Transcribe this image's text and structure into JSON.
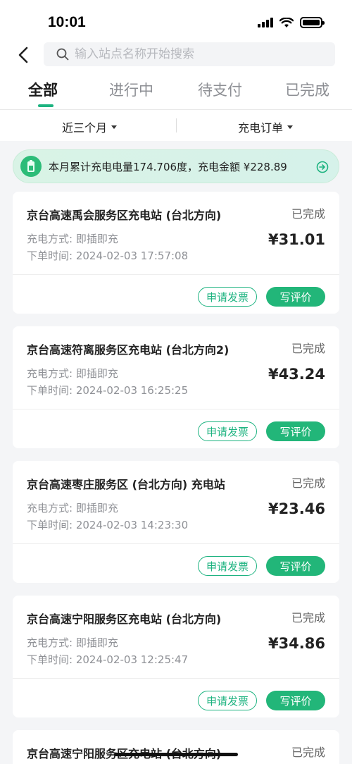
{
  "status_bar": {
    "time": "10:01"
  },
  "search": {
    "placeholder": "输入站点名称开始搜索"
  },
  "tabs": [
    {
      "label": "全部",
      "active": true
    },
    {
      "label": "进行中",
      "active": false
    },
    {
      "label": "待支付",
      "active": false
    },
    {
      "label": "已完成",
      "active": false
    }
  ],
  "filters": {
    "period": "近三个月",
    "order_type": "充电订单"
  },
  "banner": {
    "text": "本月累计充电电量174.706度，充电金额 ¥228.89"
  },
  "orders": [
    {
      "station": "京台高速禹会服务区充电站 (台北方向)",
      "status": "已完成",
      "method": "充电方式: 即插即充",
      "time": "下单时间: 2024-02-03 17:57:08",
      "amount": "¥31.01",
      "invoice_label": "申请发票",
      "review_label": "写评价"
    },
    {
      "station": "京台高速符离服务区充电站 (台北方向2)",
      "status": "已完成",
      "method": "充电方式: 即插即充",
      "time": "下单时间: 2024-02-03 16:25:25",
      "amount": "¥43.24",
      "invoice_label": "申请发票",
      "review_label": "写评价"
    },
    {
      "station": "京台高速枣庄服务区 (台北方向) 充电站",
      "status": "已完成",
      "method": "充电方式: 即插即充",
      "time": "下单时间: 2024-02-03 14:23:30",
      "amount": "¥23.46",
      "invoice_label": "申请发票",
      "review_label": "写评价"
    },
    {
      "station": "京台高速宁阳服务区充电站 (台北方向)",
      "status": "已完成",
      "method": "充电方式: 即插即充",
      "time": "下单时间: 2024-02-03 12:25:47",
      "amount": "¥34.86",
      "invoice_label": "申请发票",
      "review_label": "写评价"
    },
    {
      "station": "京台高速宁阳服务区充电站 (台北方向)",
      "status": "已完成"
    }
  ],
  "colors": {
    "accent": "#1db380",
    "banner_bg": "#d9f3e6"
  }
}
